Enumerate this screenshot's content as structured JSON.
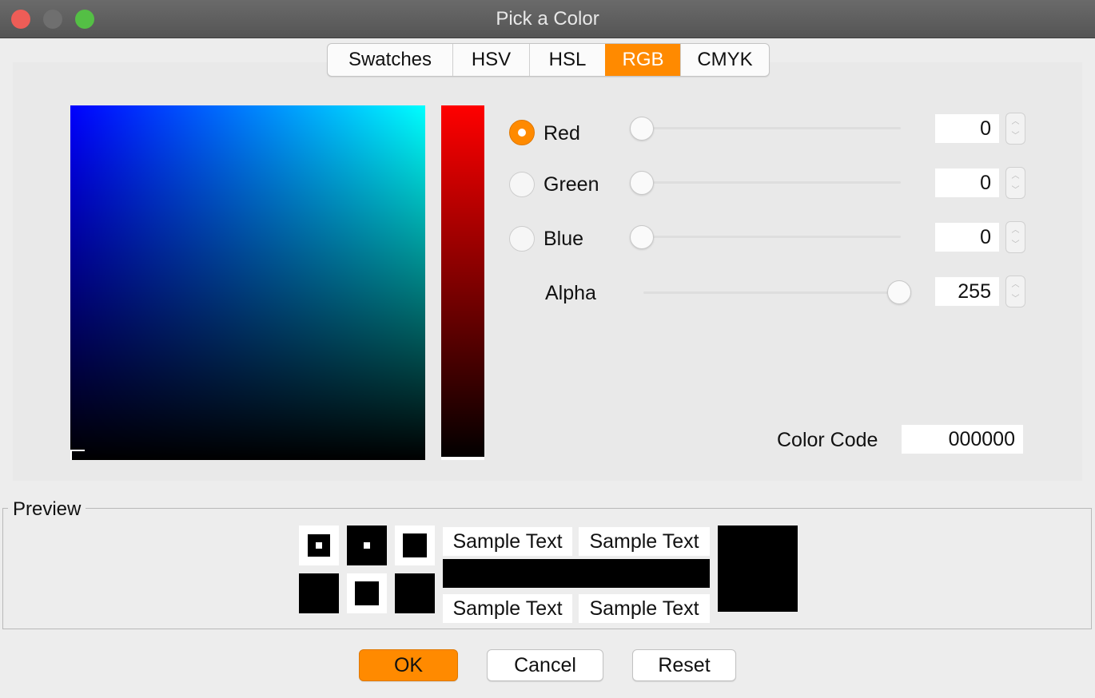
{
  "window": {
    "title": "Pick a Color"
  },
  "tabs": [
    {
      "label": "Swatches"
    },
    {
      "label": "HSV"
    },
    {
      "label": "HSL"
    },
    {
      "label": "RGB",
      "active": true
    },
    {
      "label": "CMYK"
    }
  ],
  "channels": {
    "red": {
      "label": "Red",
      "value": "0",
      "selected": true
    },
    "green": {
      "label": "Green",
      "value": "0"
    },
    "blue": {
      "label": "Blue",
      "value": "0"
    },
    "alpha": {
      "label": "Alpha",
      "value": "255"
    }
  },
  "color_code": {
    "label": "Color Code",
    "value": "000000"
  },
  "preview": {
    "title": "Preview",
    "sample_text": "Sample Text"
  },
  "buttons": {
    "ok": "OK",
    "cancel": "Cancel",
    "reset": "Reset"
  },
  "colors": {
    "accent": "#ff8a00",
    "selected_color": "#000000"
  }
}
